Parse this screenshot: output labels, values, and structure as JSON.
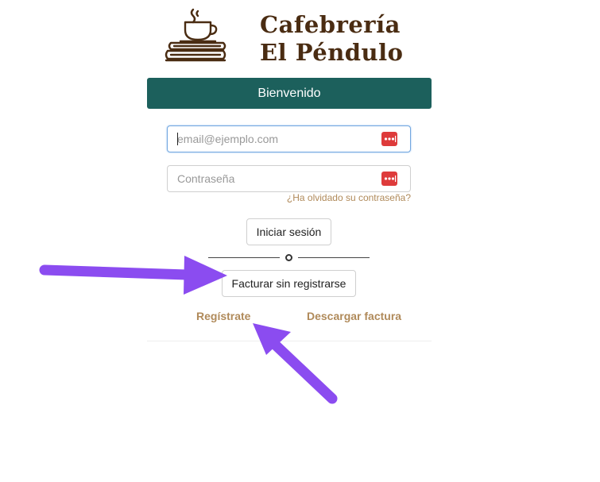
{
  "brand": {
    "line1": "Cafebrería",
    "line2": "El Péndulo",
    "text_color": "#4a2c12",
    "logo_icon": "coffee-cup-on-books-icon"
  },
  "banner": {
    "label": "Bienvenido",
    "background": "#1c605c"
  },
  "login_form": {
    "email": {
      "placeholder": "email@ejemplo.com",
      "value": ""
    },
    "password": {
      "placeholder": "Contraseña",
      "value": ""
    },
    "password_manager_icon": "password-manager-icon",
    "forgot_password_link": "¿Ha olvidado su contraseña?",
    "login_button": "Iniciar sesión"
  },
  "guest": {
    "invoice_button": "Facturar sin registrarse"
  },
  "footer_links": {
    "register": "Regístrate",
    "download_invoice": "Descargar factura"
  },
  "annotation": {
    "arrow_color": "#8b4cf0"
  },
  "colors": {
    "link": "#b08a5a",
    "focus_border": "#72a7e0",
    "badge": "#de3b3b"
  }
}
